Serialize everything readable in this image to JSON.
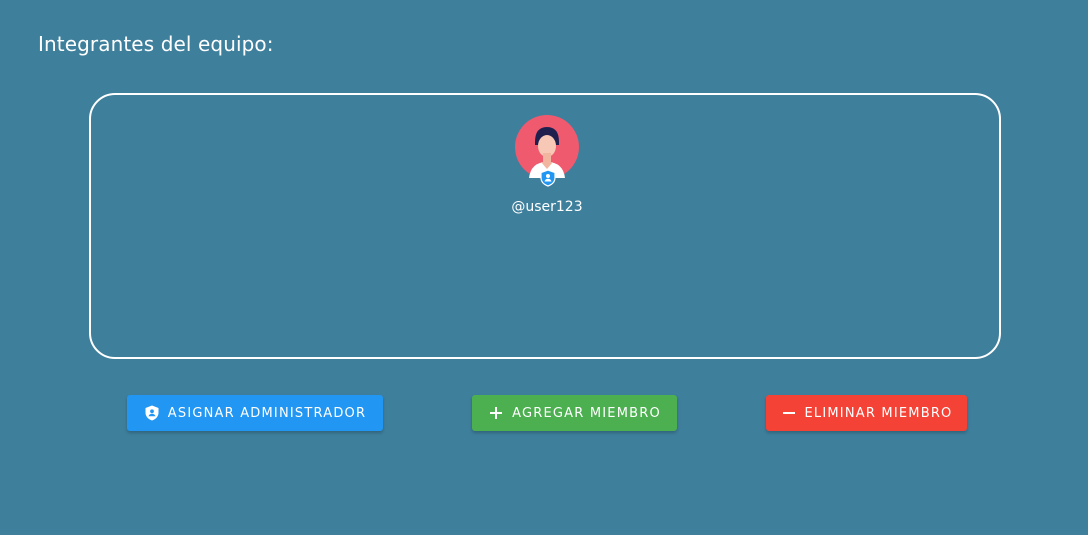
{
  "section": {
    "title": "Integrantes del equipo:"
  },
  "team": {
    "members": [
      {
        "username": "@user123",
        "avatar_icon": "user-avatar-icon",
        "role_icon": "admin-shield-icon"
      }
    ]
  },
  "actions": {
    "assign_admin": {
      "label": "ASIGNAR ADMINISTRADOR",
      "icon": "shield-user-icon",
      "color": "#2196f3"
    },
    "add_member": {
      "label": "AGREGAR MIEMBRO",
      "icon": "plus-icon",
      "color": "#4caf50"
    },
    "remove_member": {
      "label": "ELIMINAR MIEMBRO",
      "icon": "minus-icon",
      "color": "#f44336"
    }
  },
  "colors": {
    "background": "#3e7f9c",
    "border": "#ffffff",
    "avatar_bg": "#ef5a6f",
    "admin_badge": "#2196f3"
  }
}
